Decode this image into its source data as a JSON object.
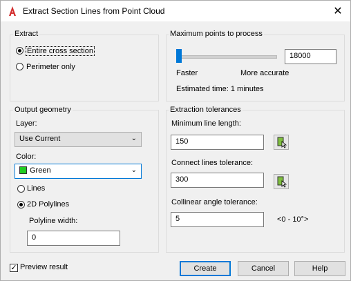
{
  "window": {
    "title": "Extract Section Lines from Point Cloud"
  },
  "extract": {
    "heading": "Extract",
    "options": [
      "Entire cross section",
      "Perimeter only"
    ],
    "selected": 0
  },
  "max_points": {
    "heading": "Maximum points to process",
    "value": "18000",
    "slider_level": 0.05,
    "left_label": "Faster",
    "right_label": "More accurate",
    "estimated": "Estimated time: 1 minutes"
  },
  "output": {
    "heading": "Output geometry",
    "layer_label": "Layer:",
    "layer_value": "Use Current",
    "color_label": "Color:",
    "color_value": "Green",
    "color_hex": "#22cc22",
    "type_options": [
      "Lines",
      "2D Polylines"
    ],
    "type_selected": 1,
    "width_label": "Polyline width:",
    "width_value": "0"
  },
  "tolerances": {
    "heading": "Extraction tolerances",
    "min_length_label": "Minimum line length:",
    "min_length_value": "150",
    "connect_label": "Connect lines tolerance:",
    "connect_value": "300",
    "collinear_label": "Collinear angle tolerance:",
    "collinear_value": "5",
    "collinear_range": "<0 - 10°>"
  },
  "footer": {
    "preview_label": "Preview result",
    "preview_checked": true,
    "create": "Create",
    "cancel": "Cancel",
    "help": "Help"
  }
}
